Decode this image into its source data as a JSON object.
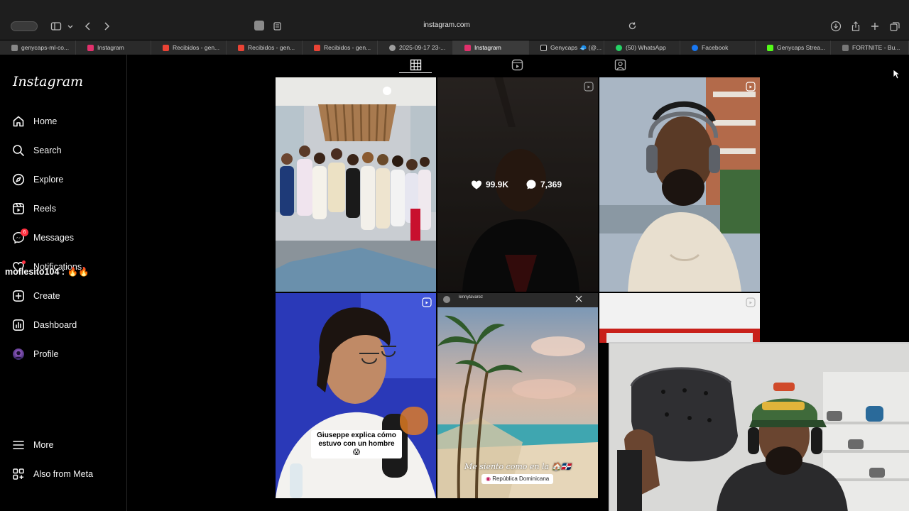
{
  "browser": {
    "url": "instagram.com",
    "tabs": [
      {
        "label": "genycaps-ml-co...",
        "color": "#888888",
        "active": false
      },
      {
        "label": "Instagram",
        "color": "#e1306c",
        "active": false
      },
      {
        "label": "Recibidos - gen...",
        "color": "#ea4335",
        "active": false
      },
      {
        "label": "Recibidos - gen...",
        "color": "#ea4335",
        "active": false
      },
      {
        "label": "Recibidos - gen...",
        "color": "#ea4335",
        "active": false
      },
      {
        "label": "2025-09-17 23-...",
        "color": "#9e9e9e",
        "active": false
      },
      {
        "label": "Instagram",
        "color": "#e1306c",
        "active": true
      },
      {
        "label": "Genycaps 🧢 (@...",
        "color": "#111111",
        "active": false
      },
      {
        "label": "(50) WhatsApp",
        "color": "#25d366",
        "active": false
      },
      {
        "label": "Facebook",
        "color": "#1877f2",
        "active": false
      },
      {
        "label": "Genycaps Strea...",
        "color": "#53fc18",
        "active": false
      },
      {
        "label": "FORTNITE - Bu...",
        "color": "#777777",
        "active": false
      }
    ]
  },
  "sidebar": {
    "logo": "Instagram",
    "items": [
      {
        "label": "Home",
        "icon": "home-icon"
      },
      {
        "label": "Search",
        "icon": "search-icon"
      },
      {
        "label": "Explore",
        "icon": "compass-icon"
      },
      {
        "label": "Reels",
        "icon": "reels-icon"
      },
      {
        "label": "Messages",
        "icon": "messenger-icon",
        "badge": "6"
      },
      {
        "label": "Notifications",
        "icon": "heart-icon"
      },
      {
        "label": "Create",
        "icon": "plus-square-icon"
      },
      {
        "label": "Dashboard",
        "icon": "chart-icon"
      },
      {
        "label": "Profile",
        "icon": "avatar-icon"
      }
    ],
    "bottom_items": [
      {
        "label": "More",
        "icon": "menu-icon"
      },
      {
        "label": "Also from Meta",
        "icon": "meta-icon"
      }
    ]
  },
  "stream_overlay": {
    "chat_message": "moflesito104 : 🔥🔥"
  },
  "profile_tabs": [
    "posts-grid-icon",
    "reels-icon",
    "tagged-icon"
  ],
  "posts": {
    "hovered": {
      "likes": "99.9K",
      "comments": "7,369"
    },
    "reel_caption": "Giuseppe explica cómo estuvo con un hombre 😱",
    "story_text": "Me siento como en la 🏠🇩🇴",
    "story_location": "República Dominicana",
    "story_user": "lennytavarez"
  },
  "colors": {
    "accent_notification": "#ff3040",
    "background": "#000000"
  }
}
